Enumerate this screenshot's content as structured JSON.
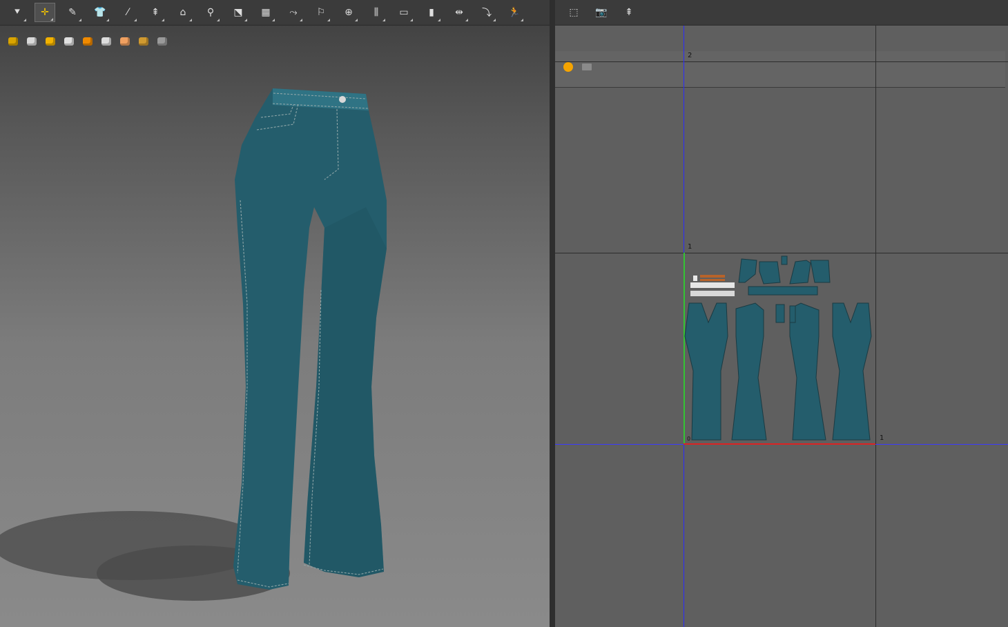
{
  "left_toolbar": {
    "tools": [
      {
        "name": "move-down-tool-icon",
        "glyph": "⯆"
      },
      {
        "name": "select-move-tool-icon",
        "glyph": "✛"
      },
      {
        "name": "edit-pattern-tool-icon",
        "glyph": "✎"
      },
      {
        "name": "garment-select-tool-icon",
        "glyph": "👕"
      },
      {
        "name": "sewing-line-tool-icon",
        "glyph": "⁄"
      },
      {
        "name": "fold-arrange-tool-icon",
        "glyph": "⇞"
      },
      {
        "name": "tack-tool-icon",
        "glyph": "⌂"
      },
      {
        "name": "avatar-pin-tool-icon",
        "glyph": "⚲"
      },
      {
        "name": "transform-tool-icon",
        "glyph": "⬔"
      },
      {
        "name": "grid-mesh-tool-icon",
        "glyph": "▦"
      },
      {
        "name": "fold-tool-icon",
        "glyph": "⤳"
      },
      {
        "name": "pin-tool-icon",
        "glyph": "⚐"
      },
      {
        "name": "lock-tool-icon",
        "glyph": "⊕"
      },
      {
        "name": "measure-tool-icon",
        "glyph": "⫼"
      },
      {
        "name": "flatten-tool-icon",
        "glyph": "▭"
      },
      {
        "name": "strengthen-tool-icon",
        "glyph": "▮"
      },
      {
        "name": "compress-tool-icon",
        "glyph": "⇹"
      },
      {
        "name": "puckering-tool-icon",
        "glyph": "⤵"
      },
      {
        "name": "avatar-walk-tool-icon",
        "glyph": "🏃"
      }
    ],
    "active_index": 1
  },
  "left_subbar": [
    {
      "name": "texture-view-icon",
      "color": "#d9a400"
    },
    {
      "name": "garment-view-icon",
      "color": "#d9d9d9"
    },
    {
      "name": "strain-map-icon",
      "color": "#f2b200"
    },
    {
      "name": "avatar-view-icon",
      "color": "#e0e0e0"
    },
    {
      "name": "light-view-icon",
      "color": "#f08a00"
    },
    {
      "name": "shadow-view-icon",
      "color": "#dcdcdc"
    },
    {
      "name": "skin-view-icon",
      "color": "#f0a060"
    },
    {
      "name": "environment-sphere-icon",
      "color": "#d09a30"
    },
    {
      "name": "export-view-icon",
      "color": "#9a9a9a"
    }
  ],
  "right_toolbar": [
    {
      "name": "select-pattern-icon",
      "glyph": "⬚"
    },
    {
      "name": "snapshot-icon",
      "glyph": "📷"
    },
    {
      "name": "arrange-pattern-icon",
      "glyph": "⇞"
    }
  ],
  "right_subbar": [
    {
      "name": "sun-light-icon",
      "color": "#f5a400"
    },
    {
      "name": "export-uv-icon",
      "color": "#8a8a8a"
    }
  ],
  "uv_axis_labels": {
    "top": "2",
    "middle": "1",
    "origin": "0",
    "right": "1"
  },
  "colors": {
    "fabric": "#245d6c",
    "fabric_light": "#2f7384",
    "stitch": "#8fa6a8"
  }
}
